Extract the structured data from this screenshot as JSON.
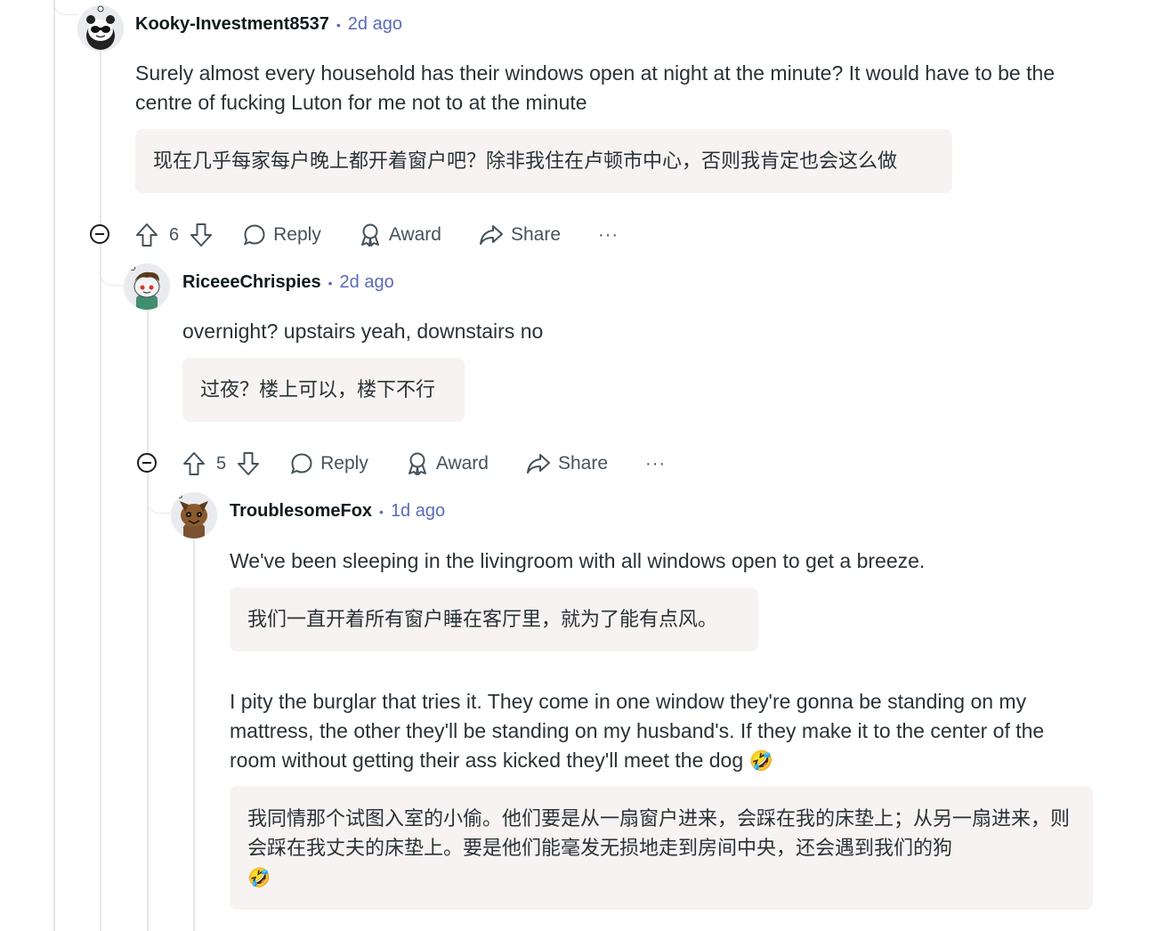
{
  "comments": [
    {
      "username": "Kooky-Investment8537",
      "time": "2d ago",
      "avatar": "panda-snoo-avatar",
      "body": "Surely almost every household has their windows open at night at the minute? It would have to be the centre of fucking Luton for me not to at the minute",
      "translation": "现在几乎每家每户晚上都开着窗户吧？除非我住在卢顿市中心，否则我肯定也会这么做",
      "votes": "6",
      "actions": {
        "reply": "Reply",
        "award": "Award",
        "share": "Share",
        "more": "···"
      }
    },
    {
      "username": "RiceeeChrispies",
      "time": "2d ago",
      "avatar": "green-hair-snoo-avatar",
      "body": "overnight? upstairs yeah, downstairs no",
      "translation": "过夜？楼上可以，楼下不行",
      "votes": "5",
      "actions": {
        "reply": "Reply",
        "award": "Award",
        "share": "Share",
        "more": "···"
      }
    },
    {
      "username": "TroublesomeFox",
      "time": "1d ago",
      "avatar": "fox-snoo-avatar",
      "body": "We've been sleeping in the livingroom with all windows open to get a breeze.",
      "translation": "我们一直开着所有窗户睡在客厅里，就为了能有点风。",
      "body2": "I pity the burglar that tries it. They come in one window they're gonna be standing on my mattress, the other they'll be standing on my husband's. If they make it to the center of the room without getting their ass kicked they'll meet the dog",
      "translation2": "我同情那个试图入室的小偷。他们要是从一扇窗户进来，会踩在我的床垫上；从另一扇进来，则会踩在我丈夫的床垫上。要是他们能毫发无损地走到房间中央，还会遇到我们的狗",
      "emoji": "🤣"
    }
  ],
  "colors": {
    "thread_line": "#e4e7ea",
    "meta_time": "#5a6bb8",
    "translation_bg": "#f7f3f2"
  }
}
